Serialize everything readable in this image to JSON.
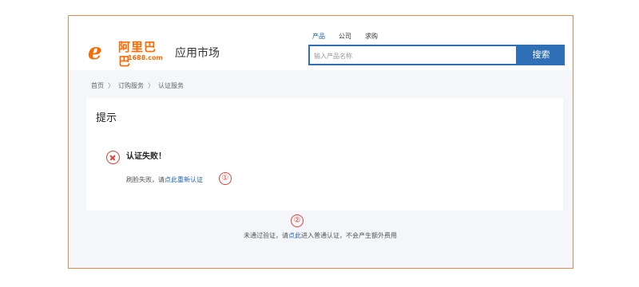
{
  "logo": {
    "mark": "e",
    "brand_cn": "阿里巴巴",
    "domain": "1688.com"
  },
  "header": {
    "market_title": "应用市场",
    "nav": [
      "产品",
      "公司",
      "求购"
    ],
    "search_placeholder": "输入产品名称",
    "search_button": "搜索"
  },
  "breadcrumb": {
    "items": [
      "首页",
      "订购服务",
      "认证服务"
    ],
    "separator": "〉"
  },
  "card": {
    "title": "提示",
    "heading": "认证失败！",
    "desc_before": "刷脸失败，请",
    "desc_link": "点此重新认证"
  },
  "markers": [
    "①",
    "②"
  ],
  "footer": {
    "before": "未通过验证，请",
    "link": "点此",
    "after": "进入普通认证，不会产生额外费用"
  },
  "colors": {
    "frame_border": "#e8884c",
    "brand_orange": "#ff6a00",
    "primary_blue": "#2e6fb5",
    "link_blue": "#1e63b8",
    "error_red": "#e3413b"
  },
  "icons": {
    "fail": "circle-x-icon"
  }
}
